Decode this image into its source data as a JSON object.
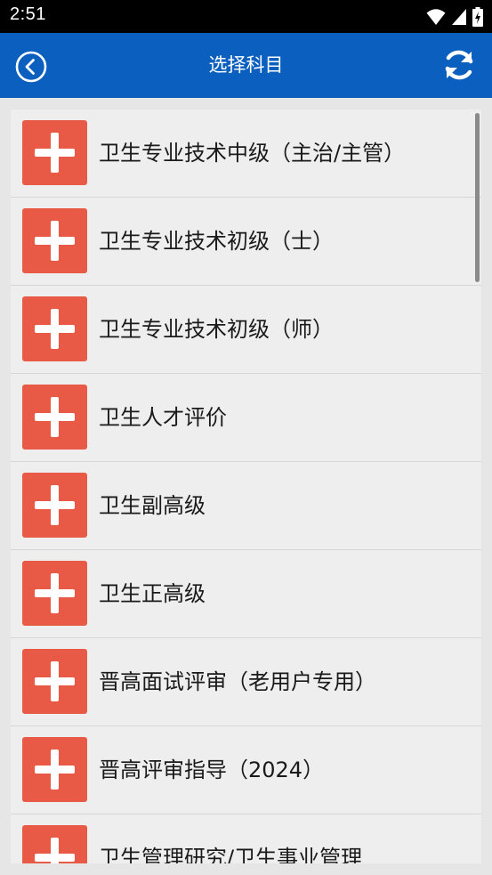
{
  "status_bar": {
    "time": "2:51",
    "icons": [
      "wifi-icon",
      "cellular-signal-icon",
      "battery-charging-icon"
    ]
  },
  "app_bar": {
    "title": "选择科目",
    "back_icon": "back-circle-icon",
    "refresh_icon": "refresh-icon"
  },
  "colors": {
    "brand": "#0b5fbf",
    "accent": "#e85a45"
  },
  "subjects": [
    {
      "label": "卫生专业技术中级（主治/主管）",
      "icon": "plus-icon"
    },
    {
      "label": "卫生专业技术初级（士）",
      "icon": "plus-icon"
    },
    {
      "label": "卫生专业技术初级（师）",
      "icon": "plus-icon"
    },
    {
      "label": "卫生人才评价",
      "icon": "plus-icon"
    },
    {
      "label": "卫生副高级",
      "icon": "plus-icon"
    },
    {
      "label": "卫生正高级",
      "icon": "plus-icon"
    },
    {
      "label": "晋高面试评审（老用户专用）",
      "icon": "plus-icon"
    },
    {
      "label": "晋高评审指导（2024）",
      "icon": "plus-icon"
    },
    {
      "label": "卫生管理研究/卫生事业管理",
      "icon": "plus-icon"
    }
  ]
}
